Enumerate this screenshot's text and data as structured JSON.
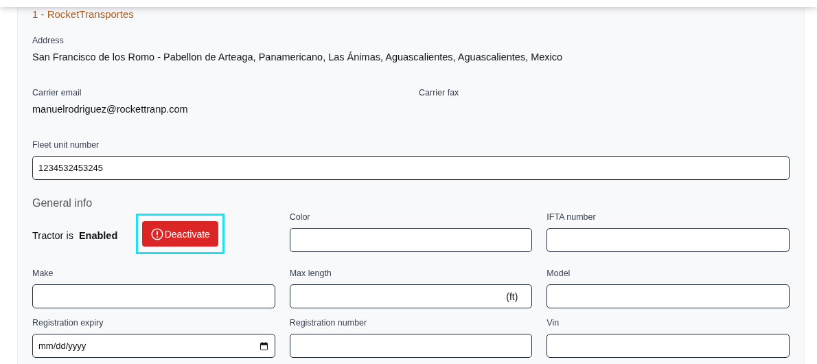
{
  "carrier_title": "1 - RocketTransportes",
  "address": {
    "label": "Address",
    "value": "San Francisco de los Romo - Pabellon de Arteaga, Panamericano, Las Ánimas, Aguascalientes, Aguascalientes, Mexico"
  },
  "contacts": [
    {
      "label": "Carrier email",
      "value": "manuelrodriguez@rockettranp.com"
    },
    {
      "label": "Carrier fax"
    }
  ],
  "fleet_unit": {
    "label": "Fleet unit number",
    "value": "1234532453245"
  },
  "general_info": {
    "title": "General info",
    "status_label": "Tractor is",
    "status_value": "Enabled",
    "button": {
      "label": "Deactivate",
      "focused": true
    }
  },
  "fields": [
    {
      "kind": "text",
      "label": "Color"
    },
    {
      "kind": "text",
      "label": "IFTA number"
    },
    {
      "kind": "text",
      "label": "Make"
    },
    {
      "kind": "suffix",
      "label": "Max length",
      "suffix": "(ft)"
    },
    {
      "kind": "text",
      "label": "Model"
    },
    {
      "kind": "date",
      "label": "Registration expiry",
      "placeholder": "mm/dd/yyyy"
    },
    {
      "kind": "text",
      "label": "Registration number"
    },
    {
      "kind": "text",
      "label": "Vin"
    }
  ]
}
